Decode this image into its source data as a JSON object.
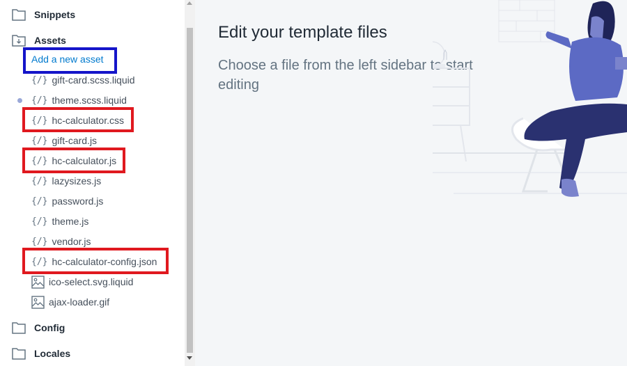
{
  "sidebar": {
    "folders": {
      "snippets": "Snippets",
      "assets": "Assets",
      "config": "Config",
      "locales": "Locales"
    },
    "add_asset": "Add a new asset",
    "files": [
      {
        "name": "gift-card.scss.liquid",
        "type": "code"
      },
      {
        "name": "theme.scss.liquid",
        "type": "code"
      },
      {
        "name": "hc-calculator.css",
        "type": "code"
      },
      {
        "name": "gift-card.js",
        "type": "code"
      },
      {
        "name": "hc-calculator.js",
        "type": "code"
      },
      {
        "name": "lazysizes.js",
        "type": "code"
      },
      {
        "name": "password.js",
        "type": "code"
      },
      {
        "name": "theme.js",
        "type": "code"
      },
      {
        "name": "vendor.js",
        "type": "code"
      },
      {
        "name": "hc-calculator-config.json",
        "type": "code"
      },
      {
        "name": "ico-select.svg.liquid",
        "type": "image"
      },
      {
        "name": "ajax-loader.gif",
        "type": "image"
      }
    ],
    "code_icon_glyph": "{/}"
  },
  "main": {
    "title": "Edit your template files",
    "description": "Choose a file from the left sidebar to start editing"
  },
  "colors": {
    "highlight_red": "#e0191f",
    "highlight_blue": "#1515c9",
    "link": "#007ace"
  }
}
